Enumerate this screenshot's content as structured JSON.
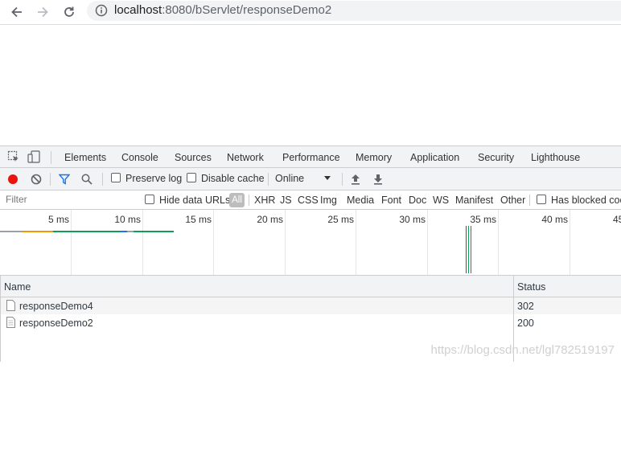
{
  "browser": {
    "url_host": "localhost",
    "url_rest": ":8080/bServlet/responseDemo2"
  },
  "devtools": {
    "tabs": [
      "Elements",
      "Console",
      "Sources",
      "Network",
      "Performance",
      "Memory",
      "Application",
      "Security",
      "Lighthouse"
    ],
    "active_tab": "Network",
    "toolbar": {
      "preserve_log": "Preserve log",
      "disable_cache": "Disable cache",
      "throttling": "Online"
    },
    "filter": {
      "placeholder": "Filter",
      "hide_data_urls": "Hide data URLs",
      "types": [
        "All",
        "XHR",
        "JS",
        "CSS",
        "Img",
        "Media",
        "Font",
        "Doc",
        "WS",
        "Manifest",
        "Other"
      ],
      "has_blocked": "Has blocked coo"
    },
    "timeline": {
      "ticks": [
        "5 ms",
        "10 ms",
        "15 ms",
        "20 ms",
        "25 ms",
        "30 ms",
        "35 ms",
        "40 ms",
        "45"
      ]
    },
    "table": {
      "columns": {
        "name": "Name",
        "status": "Status"
      },
      "rows": [
        {
          "name": "responseDemo4",
          "status": "302"
        },
        {
          "name": "responseDemo2",
          "status": "200"
        }
      ]
    }
  },
  "watermark": "https://blog.csdn.net/lgl782519197",
  "colors": {
    "record": "#e8160c",
    "active_tab_underline": "#1a73e8",
    "filter_icon": "#1a73e8"
  }
}
